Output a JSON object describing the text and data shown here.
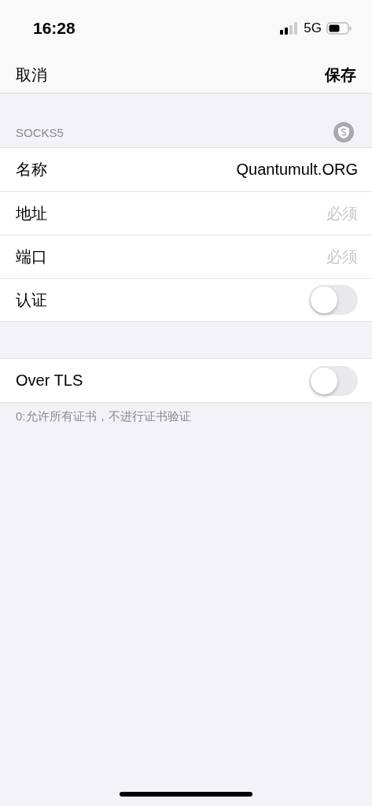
{
  "status_bar": {
    "time": "16:28",
    "network": "5G"
  },
  "nav": {
    "cancel": "取消",
    "save": "保存"
  },
  "sections": [
    {
      "header": "SOCKS5",
      "rows": [
        {
          "kind": "field",
          "label": "名称",
          "value": "Quantumult.ORG"
        },
        {
          "kind": "field",
          "label": "地址",
          "placeholder": "必须"
        },
        {
          "kind": "field",
          "label": "端口",
          "placeholder": "必须"
        },
        {
          "kind": "toggle",
          "label": "认证",
          "on": false
        }
      ]
    },
    {
      "rows": [
        {
          "kind": "toggle",
          "label": "Over TLS",
          "on": false
        }
      ],
      "footer": "0:允许所有证书，不进行证书验证"
    }
  ]
}
